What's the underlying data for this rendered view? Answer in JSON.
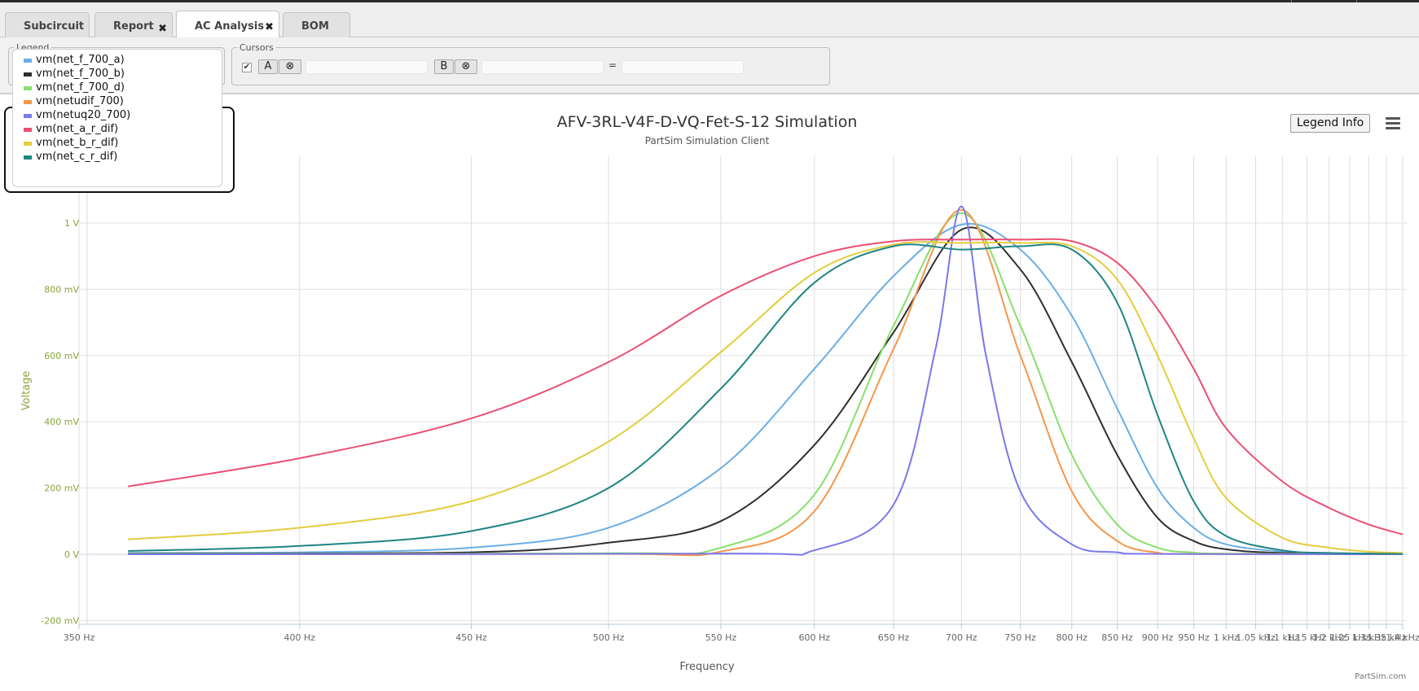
{
  "tabs": [
    {
      "label": "Subcircuit",
      "closable": false,
      "active": false
    },
    {
      "label": "Report",
      "closable": true,
      "active": false
    },
    {
      "label": "AC Analysis",
      "closable": true,
      "active": true
    },
    {
      "label": "BOM",
      "closable": false,
      "active": false
    }
  ],
  "close_glyph": "✖",
  "legend_panel": {
    "caption": "Legend",
    "items": [
      {
        "label": "vm(net_f_700_a)",
        "color": "#6aaee6"
      },
      {
        "label": "vm(net_f_700_b)",
        "color": "#2f2f2f"
      },
      {
        "label": "vm(net_f_700_d)",
        "color": "#88e06a"
      },
      {
        "label": "vm(netudif_700)",
        "color": "#f5964a"
      },
      {
        "label": "vm(netuq20_700)",
        "color": "#7b79e8"
      },
      {
        "label": "vm(net_a_r_dif)",
        "color": "#ea4f74"
      },
      {
        "label": "vm(net_b_r_dif)",
        "color": "#e3cd3e"
      },
      {
        "label": "vm(net_c_r_dif)",
        "color": "#1f8583"
      }
    ]
  },
  "cursors": {
    "caption": "Cursors",
    "checkbox_glyph": "✔",
    "a_label": "A",
    "b_label": "B",
    "clear_glyph": "⊗",
    "equals": "="
  },
  "legend_info_button": "Legend Info",
  "credit": "PartSim.com",
  "chart_data": {
    "type": "line",
    "title": "AFV-3RL-V4F-D-VQ-Fet-S-12 Simulation",
    "subtitle": "PartSim Simulation Client",
    "xlabel": "Frequency",
    "ylabel": "Voltage",
    "x_scale": "reciprocal",
    "xlim_hz": [
      350,
      1400
    ],
    "ylim_v": [
      -0.2,
      1.0
    ],
    "grid": true,
    "xticks": [
      {
        "hz": 350,
        "label": "350 Hz"
      },
      {
        "hz": 400,
        "label": "400 Hz"
      },
      {
        "hz": 450,
        "label": "450 Hz"
      },
      {
        "hz": 500,
        "label": "500 Hz"
      },
      {
        "hz": 550,
        "label": "550 Hz"
      },
      {
        "hz": 600,
        "label": "600 Hz"
      },
      {
        "hz": 650,
        "label": "650 Hz"
      },
      {
        "hz": 700,
        "label": "700 Hz"
      },
      {
        "hz": 750,
        "label": "750 Hz"
      },
      {
        "hz": 800,
        "label": "800 Hz"
      },
      {
        "hz": 850,
        "label": "850 Hz"
      },
      {
        "hz": 900,
        "label": "900 Hz"
      },
      {
        "hz": 950,
        "label": "950 Hz"
      },
      {
        "hz": 1000,
        "label": "1 kHz"
      },
      {
        "hz": 1050,
        "label": "1.05 kHz"
      },
      {
        "hz": 1100,
        "label": "1.1 kHz"
      },
      {
        "hz": 1150,
        "label": "1.15 kHz"
      },
      {
        "hz": 1200,
        "label": "1.2 kHz"
      },
      {
        "hz": 1250,
        "label": "1.25 kHz"
      },
      {
        "hz": 1300,
        "label": "1.3 kHz"
      },
      {
        "hz": 1350,
        "label": "1.35 kHz"
      },
      {
        "hz": 1400,
        "label": "1.4 kHz"
      }
    ],
    "yticks": [
      {
        "v": -0.2,
        "label": "-200 mV"
      },
      {
        "v": 0,
        "label": "0 V"
      },
      {
        "v": 0.2,
        "label": "200 mV"
      },
      {
        "v": 0.4,
        "label": "400 mV"
      },
      {
        "v": 0.6,
        "label": "600 mV"
      },
      {
        "v": 0.8,
        "label": "800 mV"
      },
      {
        "v": 1.0,
        "label": "1 V"
      }
    ],
    "series": [
      {
        "name": "vm(net_f_700_a)",
        "color": "#6aaee6",
        "points": [
          [
            360,
            0.004
          ],
          [
            400,
            0.006
          ],
          [
            450,
            0.02
          ],
          [
            500,
            0.08
          ],
          [
            550,
            0.26
          ],
          [
            600,
            0.56
          ],
          [
            650,
            0.84
          ],
          [
            700,
            0.995
          ],
          [
            750,
            0.92
          ],
          [
            800,
            0.72
          ],
          [
            850,
            0.44
          ],
          [
            900,
            0.2
          ],
          [
            950,
            0.08
          ],
          [
            1000,
            0.03
          ],
          [
            1100,
            0.008
          ],
          [
            1200,
            0.003
          ],
          [
            1400,
            0.001
          ]
        ]
      },
      {
        "name": "vm(net_f_700_b)",
        "color": "#2f2f2f",
        "points": [
          [
            360,
            0.002
          ],
          [
            450,
            0.006
          ],
          [
            500,
            0.035
          ],
          [
            550,
            0.1
          ],
          [
            600,
            0.33
          ],
          [
            650,
            0.67
          ],
          [
            700,
            0.98
          ],
          [
            750,
            0.86
          ],
          [
            800,
            0.58
          ],
          [
            850,
            0.3
          ],
          [
            900,
            0.11
          ],
          [
            950,
            0.04
          ],
          [
            1000,
            0.015
          ],
          [
            1100,
            0.004
          ],
          [
            1400,
            0.001
          ]
        ]
      },
      {
        "name": "vm(net_f_700_d)",
        "color": "#88e06a",
        "points": [
          [
            360,
            0.001
          ],
          [
            500,
            0.003
          ],
          [
            550,
            0.02
          ],
          [
            600,
            0.18
          ],
          [
            650,
            0.69
          ],
          [
            700,
            1.03
          ],
          [
            750,
            0.69
          ],
          [
            800,
            0.3
          ],
          [
            850,
            0.09
          ],
          [
            900,
            0.02
          ],
          [
            950,
            0.005
          ],
          [
            1000,
            0.002
          ],
          [
            1400,
            0.0
          ]
        ]
      },
      {
        "name": "vm(netudif_700)",
        "color": "#f5964a",
        "points": [
          [
            360,
            0.0
          ],
          [
            500,
            0.001
          ],
          [
            550,
            0.008
          ],
          [
            600,
            0.13
          ],
          [
            650,
            0.62
          ],
          [
            700,
            1.04
          ],
          [
            750,
            0.6
          ],
          [
            800,
            0.19
          ],
          [
            850,
            0.04
          ],
          [
            900,
            0.005
          ],
          [
            950,
            0.001
          ],
          [
            1400,
            0.0
          ]
        ]
      },
      {
        "name": "vm(netuq20_700)",
        "color": "#7b79e8",
        "points": [
          [
            360,
            0.0
          ],
          [
            550,
            0.002
          ],
          [
            600,
            0.012
          ],
          [
            650,
            0.15
          ],
          [
            680,
            0.62
          ],
          [
            700,
            1.05
          ],
          [
            720,
            0.6
          ],
          [
            750,
            0.19
          ],
          [
            800,
            0.03
          ],
          [
            850,
            0.006
          ],
          [
            900,
            0.001
          ],
          [
            1400,
            0.0
          ]
        ]
      },
      {
        "name": "vm(net_a_r_dif)",
        "color": "#ea4f74",
        "points": [
          [
            360,
            0.205
          ],
          [
            400,
            0.29
          ],
          [
            450,
            0.41
          ],
          [
            500,
            0.58
          ],
          [
            550,
            0.78
          ],
          [
            600,
            0.9
          ],
          [
            650,
            0.945
          ],
          [
            700,
            0.95
          ],
          [
            750,
            0.95
          ],
          [
            800,
            0.945
          ],
          [
            850,
            0.88
          ],
          [
            900,
            0.74
          ],
          [
            950,
            0.56
          ],
          [
            1000,
            0.38
          ],
          [
            1100,
            0.22
          ],
          [
            1200,
            0.14
          ],
          [
            1300,
            0.09
          ],
          [
            1400,
            0.06
          ]
        ]
      },
      {
        "name": "vm(net_b_r_dif)",
        "color": "#e3cd3e",
        "points": [
          [
            360,
            0.045
          ],
          [
            400,
            0.08
          ],
          [
            450,
            0.16
          ],
          [
            500,
            0.34
          ],
          [
            550,
            0.61
          ],
          [
            600,
            0.85
          ],
          [
            650,
            0.935
          ],
          [
            700,
            0.94
          ],
          [
            750,
            0.94
          ],
          [
            800,
            0.93
          ],
          [
            850,
            0.83
          ],
          [
            900,
            0.6
          ],
          [
            950,
            0.35
          ],
          [
            1000,
            0.17
          ],
          [
            1100,
            0.05
          ],
          [
            1200,
            0.02
          ],
          [
            1300,
            0.008
          ],
          [
            1400,
            0.004
          ]
        ]
      },
      {
        "name": "vm(net_c_r_dif)",
        "color": "#1f8583",
        "points": [
          [
            360,
            0.01
          ],
          [
            400,
            0.025
          ],
          [
            450,
            0.07
          ],
          [
            500,
            0.2
          ],
          [
            550,
            0.5
          ],
          [
            600,
            0.82
          ],
          [
            650,
            0.93
          ],
          [
            700,
            0.92
          ],
          [
            750,
            0.93
          ],
          [
            800,
            0.92
          ],
          [
            850,
            0.76
          ],
          [
            900,
            0.42
          ],
          [
            950,
            0.16
          ],
          [
            1000,
            0.055
          ],
          [
            1100,
            0.012
          ],
          [
            1200,
            0.004
          ],
          [
            1400,
            0.001
          ]
        ]
      }
    ]
  }
}
